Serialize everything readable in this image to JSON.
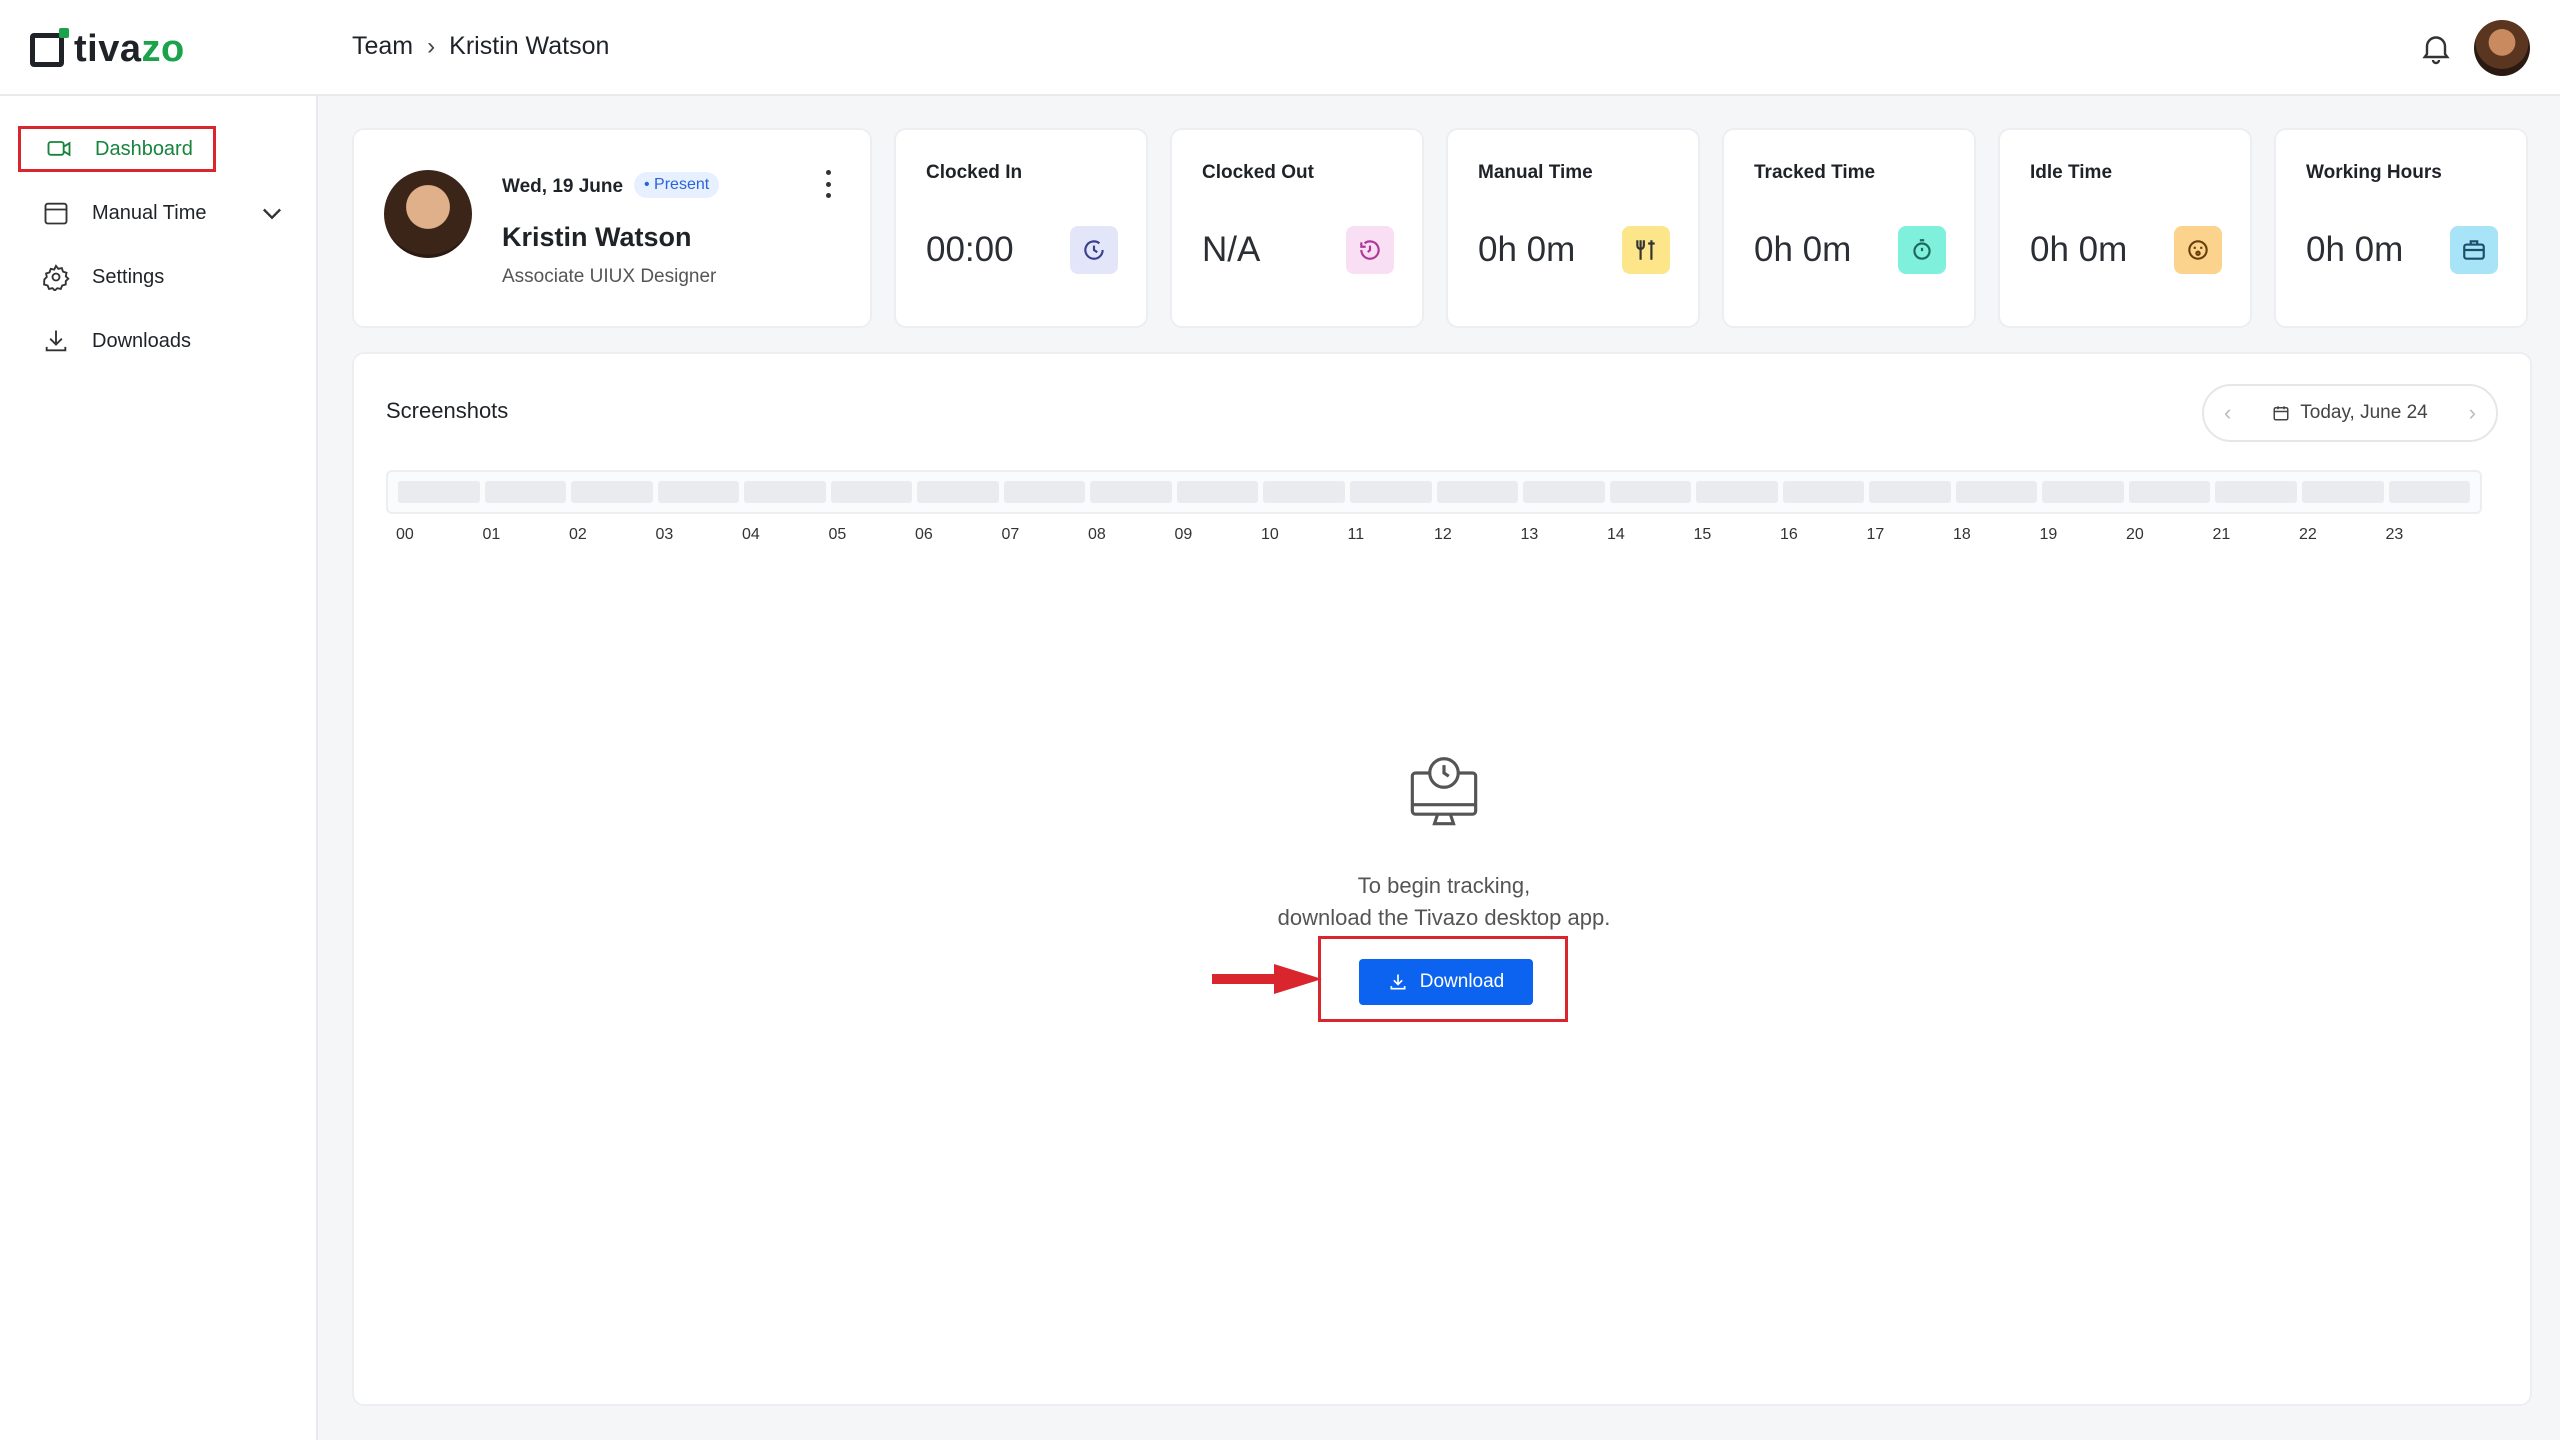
{
  "app": {
    "brand_main": "tiva",
    "brand_accent": "zo",
    "brand_tail": ""
  },
  "breadcrumb": {
    "parent": "Team",
    "current": "Kristin Watson"
  },
  "sidebar": {
    "items": [
      {
        "label": "Dashboard",
        "icon": "dashboard-icon",
        "active": true
      },
      {
        "label": "Manual Time",
        "icon": "calendar-icon",
        "expandable": true
      },
      {
        "label": "Settings",
        "icon": "gear-icon"
      },
      {
        "label": "Downloads",
        "icon": "download-icon"
      }
    ]
  },
  "profile": {
    "date": "Wed, 19 June",
    "status": "• Present",
    "name": "Kristin Watson",
    "role": "Associate UIUX Designer"
  },
  "stats": [
    {
      "label": "Clocked In",
      "value": "00:00",
      "icon": "clock-in-icon",
      "color": "#e3e6f8"
    },
    {
      "label": "Clocked Out",
      "value": "N/A",
      "icon": "clock-out-icon",
      "color": "#f8dff3"
    },
    {
      "label": "Manual Time",
      "value": "0h 0m",
      "icon": "tools-icon",
      "color": "#fde68a"
    },
    {
      "label": "Tracked Time",
      "value": "0h 0m",
      "icon": "timer-icon",
      "color": "#7ff0dc"
    },
    {
      "label": "Idle Time",
      "value": "0h 0m",
      "icon": "sleep-face-icon",
      "color": "#fcd38d"
    },
    {
      "label": "Working Hours",
      "value": "0h 0m",
      "icon": "briefcase-icon",
      "color": "#a8e4f8"
    }
  ],
  "screenshots": {
    "title": "Screenshots",
    "date_label": "Today, June 24",
    "hours": [
      "00",
      "01",
      "02",
      "03",
      "04",
      "05",
      "06",
      "07",
      "08",
      "09",
      "10",
      "11",
      "12",
      "13",
      "14",
      "15",
      "16",
      "17",
      "18",
      "19",
      "20",
      "21",
      "22",
      "23"
    ],
    "empty_line1": "To begin tracking,",
    "empty_line2": "download the Tivazo desktop app.",
    "download_label": "Download"
  },
  "colors": {
    "accent_green": "#1aa34a",
    "primary_blue": "#0b63f0",
    "highlight_red": "#d9262e"
  }
}
